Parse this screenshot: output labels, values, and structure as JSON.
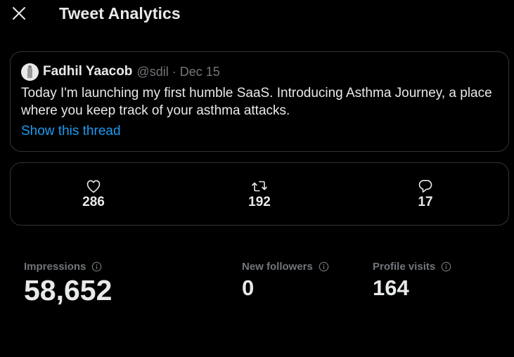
{
  "header": {
    "title": "Tweet Analytics",
    "close_icon": "close-icon"
  },
  "tweet": {
    "author_name": "Fadhil Yaacob",
    "handle": "@sdil",
    "separator": "·",
    "date": "Dec 15",
    "text": "Today I'm launching my first humble SaaS. Introducing Asthma Journey, a place where you keep track of your asthma attacks.",
    "thread_link": "Show this thread",
    "link_color": "#1d9bf0"
  },
  "engagement": {
    "likes": {
      "icon": "heart-icon",
      "count": "286"
    },
    "retweets": {
      "icon": "retweet-icon",
      "count": "192"
    },
    "replies": {
      "icon": "reply-icon",
      "count": "17"
    }
  },
  "metrics": {
    "impressions": {
      "label": "Impressions",
      "value": "58,652",
      "icon": "info-icon"
    },
    "new_followers": {
      "label": "New followers",
      "value": "0",
      "icon": "info-icon"
    },
    "profile_visits": {
      "label": "Profile visits",
      "value": "164",
      "icon": "info-icon"
    }
  },
  "colors": {
    "background": "#000000",
    "text_primary": "#e7e9ea",
    "text_secondary": "#71767b",
    "border": "#2f3336"
  }
}
